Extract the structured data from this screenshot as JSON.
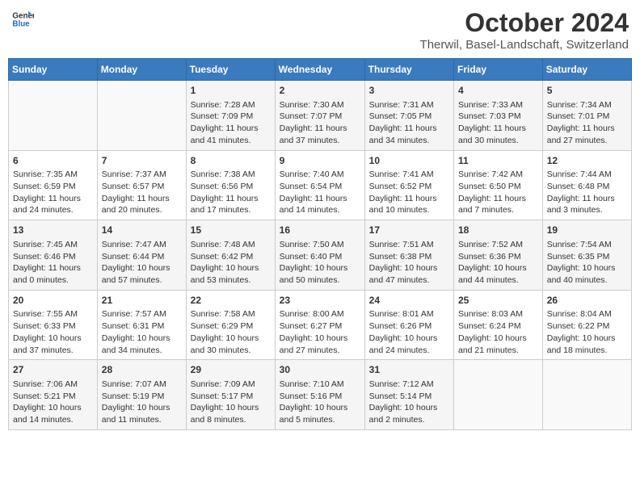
{
  "header": {
    "logo_line1": "General",
    "logo_line2": "Blue",
    "month": "October 2024",
    "location": "Therwil, Basel-Landschaft, Switzerland"
  },
  "days_of_week": [
    "Sunday",
    "Monday",
    "Tuesday",
    "Wednesday",
    "Thursday",
    "Friday",
    "Saturday"
  ],
  "weeks": [
    [
      {
        "day": "",
        "content": ""
      },
      {
        "day": "",
        "content": ""
      },
      {
        "day": "1",
        "content": "Sunrise: 7:28 AM\nSunset: 7:09 PM\nDaylight: 11 hours and 41 minutes."
      },
      {
        "day": "2",
        "content": "Sunrise: 7:30 AM\nSunset: 7:07 PM\nDaylight: 11 hours and 37 minutes."
      },
      {
        "day": "3",
        "content": "Sunrise: 7:31 AM\nSunset: 7:05 PM\nDaylight: 11 hours and 34 minutes."
      },
      {
        "day": "4",
        "content": "Sunrise: 7:33 AM\nSunset: 7:03 PM\nDaylight: 11 hours and 30 minutes."
      },
      {
        "day": "5",
        "content": "Sunrise: 7:34 AM\nSunset: 7:01 PM\nDaylight: 11 hours and 27 minutes."
      }
    ],
    [
      {
        "day": "6",
        "content": "Sunrise: 7:35 AM\nSunset: 6:59 PM\nDaylight: 11 hours and 24 minutes."
      },
      {
        "day": "7",
        "content": "Sunrise: 7:37 AM\nSunset: 6:57 PM\nDaylight: 11 hours and 20 minutes."
      },
      {
        "day": "8",
        "content": "Sunrise: 7:38 AM\nSunset: 6:56 PM\nDaylight: 11 hours and 17 minutes."
      },
      {
        "day": "9",
        "content": "Sunrise: 7:40 AM\nSunset: 6:54 PM\nDaylight: 11 hours and 14 minutes."
      },
      {
        "day": "10",
        "content": "Sunrise: 7:41 AM\nSunset: 6:52 PM\nDaylight: 11 hours and 10 minutes."
      },
      {
        "day": "11",
        "content": "Sunrise: 7:42 AM\nSunset: 6:50 PM\nDaylight: 11 hours and 7 minutes."
      },
      {
        "day": "12",
        "content": "Sunrise: 7:44 AM\nSunset: 6:48 PM\nDaylight: 11 hours and 3 minutes."
      }
    ],
    [
      {
        "day": "13",
        "content": "Sunrise: 7:45 AM\nSunset: 6:46 PM\nDaylight: 11 hours and 0 minutes."
      },
      {
        "day": "14",
        "content": "Sunrise: 7:47 AM\nSunset: 6:44 PM\nDaylight: 10 hours and 57 minutes."
      },
      {
        "day": "15",
        "content": "Sunrise: 7:48 AM\nSunset: 6:42 PM\nDaylight: 10 hours and 53 minutes."
      },
      {
        "day": "16",
        "content": "Sunrise: 7:50 AM\nSunset: 6:40 PM\nDaylight: 10 hours and 50 minutes."
      },
      {
        "day": "17",
        "content": "Sunrise: 7:51 AM\nSunset: 6:38 PM\nDaylight: 10 hours and 47 minutes."
      },
      {
        "day": "18",
        "content": "Sunrise: 7:52 AM\nSunset: 6:36 PM\nDaylight: 10 hours and 44 minutes."
      },
      {
        "day": "19",
        "content": "Sunrise: 7:54 AM\nSunset: 6:35 PM\nDaylight: 10 hours and 40 minutes."
      }
    ],
    [
      {
        "day": "20",
        "content": "Sunrise: 7:55 AM\nSunset: 6:33 PM\nDaylight: 10 hours and 37 minutes."
      },
      {
        "day": "21",
        "content": "Sunrise: 7:57 AM\nSunset: 6:31 PM\nDaylight: 10 hours and 34 minutes."
      },
      {
        "day": "22",
        "content": "Sunrise: 7:58 AM\nSunset: 6:29 PM\nDaylight: 10 hours and 30 minutes."
      },
      {
        "day": "23",
        "content": "Sunrise: 8:00 AM\nSunset: 6:27 PM\nDaylight: 10 hours and 27 minutes."
      },
      {
        "day": "24",
        "content": "Sunrise: 8:01 AM\nSunset: 6:26 PM\nDaylight: 10 hours and 24 minutes."
      },
      {
        "day": "25",
        "content": "Sunrise: 8:03 AM\nSunset: 6:24 PM\nDaylight: 10 hours and 21 minutes."
      },
      {
        "day": "26",
        "content": "Sunrise: 8:04 AM\nSunset: 6:22 PM\nDaylight: 10 hours and 18 minutes."
      }
    ],
    [
      {
        "day": "27",
        "content": "Sunrise: 7:06 AM\nSunset: 5:21 PM\nDaylight: 10 hours and 14 minutes."
      },
      {
        "day": "28",
        "content": "Sunrise: 7:07 AM\nSunset: 5:19 PM\nDaylight: 10 hours and 11 minutes."
      },
      {
        "day": "29",
        "content": "Sunrise: 7:09 AM\nSunset: 5:17 PM\nDaylight: 10 hours and 8 minutes."
      },
      {
        "day": "30",
        "content": "Sunrise: 7:10 AM\nSunset: 5:16 PM\nDaylight: 10 hours and 5 minutes."
      },
      {
        "day": "31",
        "content": "Sunrise: 7:12 AM\nSunset: 5:14 PM\nDaylight: 10 hours and 2 minutes."
      },
      {
        "day": "",
        "content": ""
      },
      {
        "day": "",
        "content": ""
      }
    ]
  ]
}
